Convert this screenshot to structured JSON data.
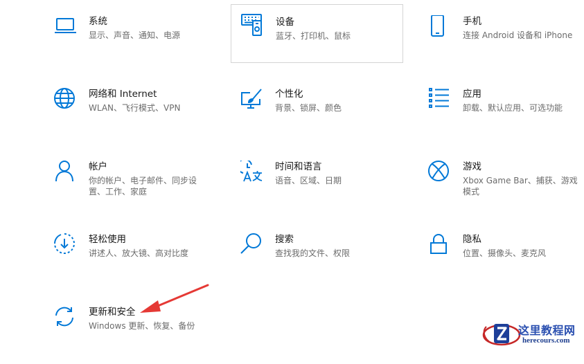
{
  "settings": {
    "tiles": [
      {
        "title": "系统",
        "desc": "显示、声音、通知、电源",
        "icon": "laptop-icon"
      },
      {
        "title": "设备",
        "desc": "蓝牙、打印机、鼠标",
        "icon": "devices-icon"
      },
      {
        "title": "手机",
        "desc": "连接 Android 设备和 iPhone",
        "icon": "phone-icon"
      },
      {
        "title": "网络和 Internet",
        "desc": "WLAN、飞行模式、VPN",
        "icon": "globe-icon"
      },
      {
        "title": "个性化",
        "desc": "背景、锁屏、颜色",
        "icon": "paint-icon"
      },
      {
        "title": "应用",
        "desc": "卸载、默认应用、可选功能",
        "icon": "apps-list-icon"
      },
      {
        "title": "帐户",
        "desc": "你的帐户、电子邮件、同步设置、工作、家庭",
        "icon": "person-icon"
      },
      {
        "title": "时间和语言",
        "desc": "语音、区域、日期",
        "icon": "time-language-icon"
      },
      {
        "title": "游戏",
        "desc": "Xbox Game Bar、捕获、游戏模式",
        "icon": "xbox-icon"
      },
      {
        "title": "轻松使用",
        "desc": "讲述人、放大镜、高对比度",
        "icon": "ease-of-access-icon"
      },
      {
        "title": "搜索",
        "desc": "查找我的文件、权限",
        "icon": "search-icon"
      },
      {
        "title": "隐私",
        "desc": "位置、摄像头、麦克风",
        "icon": "lock-icon"
      },
      {
        "title": "更新和安全",
        "desc": "Windows 更新、恢复、备份",
        "icon": "update-icon"
      }
    ]
  },
  "watermark": {
    "cn": "这里教程网",
    "en": "herecours.com"
  },
  "colors": {
    "accent": "#0078d7",
    "annotation_arrow": "#e53935"
  }
}
